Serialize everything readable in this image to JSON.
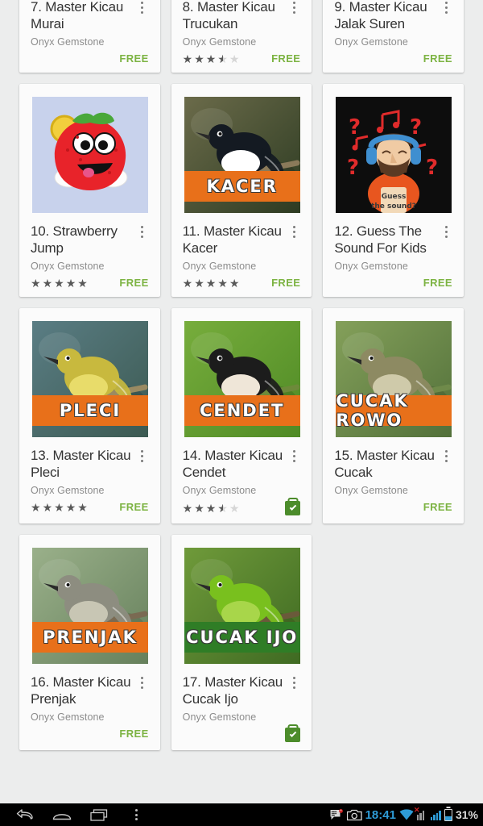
{
  "app_grid": {
    "rows": [
      {
        "clipped": true,
        "cards": [
          {
            "title": "7. Master Kicau Murai",
            "developer": "Onyx Gemstone",
            "rating": 0,
            "price_label": "FREE",
            "has_thumb": false,
            "installed": false
          },
          {
            "title": "8. Master Kicau Trucukan",
            "developer": "Onyx Gemstone",
            "rating": 3.5,
            "price_label": "FREE",
            "has_thumb": false,
            "installed": false
          },
          {
            "title": "9. Master Kicau Jalak Suren",
            "developer": "Onyx Gemstone",
            "rating": 0,
            "price_label": "FREE",
            "has_thumb": false,
            "installed": false
          }
        ]
      },
      {
        "clipped": false,
        "cards": [
          {
            "title": "10. Strawberry Jump",
            "developer": "Onyx Gemstone",
            "rating": 5,
            "price_label": "FREE",
            "has_thumb": true,
            "thumb_kind": "strawberry",
            "thumb_label": "",
            "installed": false
          },
          {
            "title": "11. Master Kicau Kacer",
            "developer": "Onyx Gemstone",
            "rating": 5,
            "price_label": "FREE",
            "has_thumb": true,
            "thumb_kind": "bird-kacer",
            "thumb_label": "KACER",
            "thumb_label_color": "orange",
            "installed": false
          },
          {
            "title": "12. Guess The Sound For Kids",
            "developer": "Onyx Gemstone",
            "rating": 0,
            "price_label": "FREE",
            "has_thumb": true,
            "thumb_kind": "guess-sound",
            "thumb_label": "",
            "installed": false
          }
        ]
      },
      {
        "clipped": false,
        "cards": [
          {
            "title": "13. Master Kicau Pleci",
            "developer": "Onyx Gemstone",
            "rating": 5,
            "price_label": "FREE",
            "has_thumb": true,
            "thumb_kind": "bird-pleci",
            "thumb_label": "PLECI",
            "thumb_label_color": "orange",
            "installed": false
          },
          {
            "title": "14. Master Kicau Cendet",
            "developer": "Onyx Gemstone",
            "rating": 3.5,
            "price_label": "",
            "has_thumb": true,
            "thumb_kind": "bird-cendet",
            "thumb_label": "CENDET",
            "thumb_label_color": "orange",
            "installed": true
          },
          {
            "title": "15. Master Kicau Cucak",
            "developer": "Onyx Gemstone",
            "rating": 0,
            "price_label": "FREE",
            "has_thumb": true,
            "thumb_kind": "bird-cucak-rowo",
            "thumb_label": "CUCAK ROWO",
            "thumb_label_color": "orange",
            "installed": false
          }
        ]
      },
      {
        "clipped": false,
        "cards": [
          {
            "title": "16. Master Kicau Prenjak",
            "developer": "Onyx Gemstone",
            "rating": 0,
            "price_label": "FREE",
            "has_thumb": true,
            "thumb_kind": "bird-prenjak",
            "thumb_label": "PRENJAK",
            "thumb_label_color": "orange",
            "installed": false
          },
          {
            "title": "17. Master Kicau Cucak Ijo",
            "developer": "Onyx Gemstone",
            "rating": 0,
            "price_label": "",
            "has_thumb": true,
            "thumb_kind": "bird-cucak-ijo",
            "thumb_label": "CUCAK IJO",
            "thumb_label_color": "green",
            "installed": true
          },
          {
            "empty": true
          }
        ]
      }
    ]
  },
  "system_bar": {
    "nav": [
      {
        "name": "back-button",
        "icon": "back-arrow-icon"
      },
      {
        "name": "home-button",
        "icon": "home-dome-icon"
      },
      {
        "name": "recents-button",
        "icon": "recents-rectangle-icon"
      },
      {
        "name": "menu-button",
        "icon": "overflow-menu-icon"
      }
    ],
    "status": {
      "messages_icon": "messages-badge-icon",
      "camera_icon": "camera-icon",
      "clock": "18:41",
      "wifi_icon": "wifi-icon",
      "signal1_icon": "signal-no-service-icon",
      "signal2_icon": "signal-bars-icon",
      "battery_icon": "battery-icon",
      "battery_text": "31%"
    }
  },
  "colors": {
    "page_bg": "#eceded",
    "card_bg": "#fbfbfb",
    "title": "#333333",
    "developer": "#8c8c8c",
    "price_green": "#7cb342",
    "installed_green": "#4c8c2b",
    "clock_blue": "#2e9bd6",
    "label_orange": "#e8701a",
    "label_green": "#2f7d26"
  }
}
